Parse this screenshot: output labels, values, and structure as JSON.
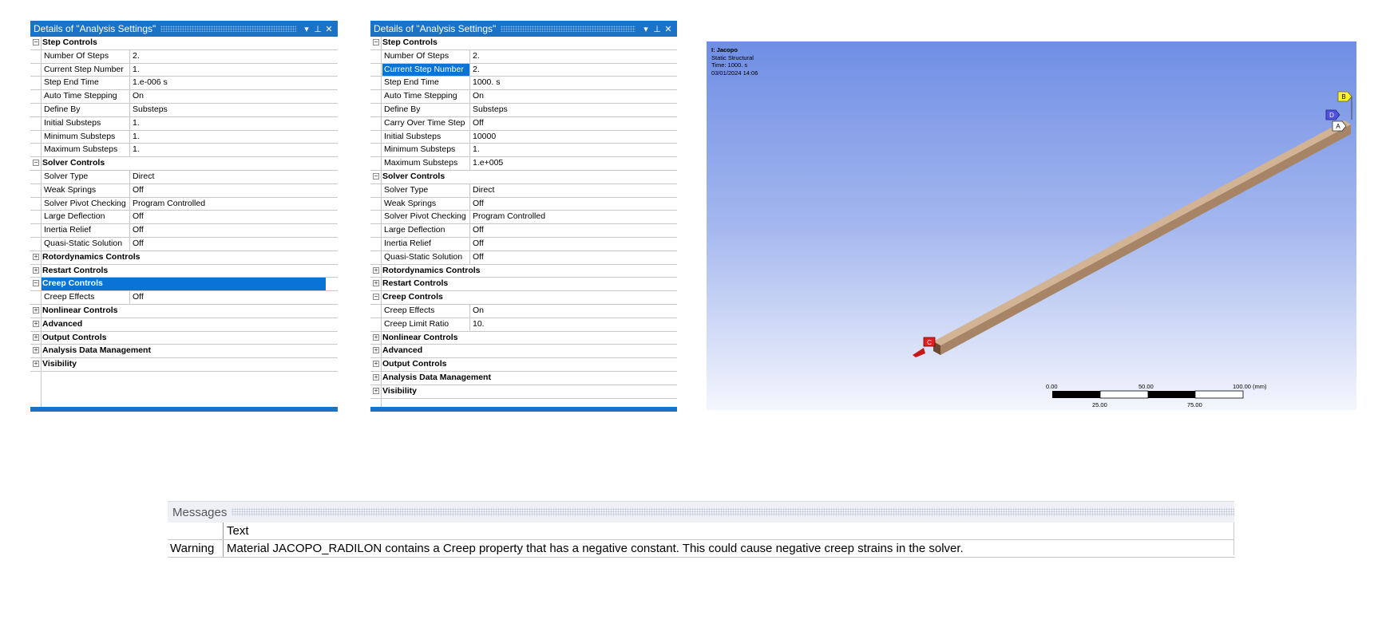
{
  "panel1": {
    "title": "Details of \"Analysis Settings\"",
    "buttons": {
      "menu": "▾",
      "pin": "⊥",
      "close": "✕"
    },
    "rows": [
      {
        "type": "group",
        "label": "Step Controls",
        "state": "−"
      },
      {
        "type": "prop",
        "label": "Number Of Steps",
        "value": "2."
      },
      {
        "type": "prop",
        "label": "Current Step Number",
        "value": "1."
      },
      {
        "type": "prop",
        "label": "Step End Time",
        "value": "1.e-006 s"
      },
      {
        "type": "prop",
        "label": "Auto Time Stepping",
        "value": "On"
      },
      {
        "type": "prop",
        "label": "Define By",
        "value": "Substeps"
      },
      {
        "type": "prop",
        "label": "Initial Substeps",
        "value": "1."
      },
      {
        "type": "prop",
        "label": "Minimum Substeps",
        "value": "1."
      },
      {
        "type": "prop",
        "label": "Maximum Substeps",
        "value": "1."
      },
      {
        "type": "group",
        "label": "Solver Controls",
        "state": "−"
      },
      {
        "type": "prop",
        "label": "Solver Type",
        "value": "Direct"
      },
      {
        "type": "prop",
        "label": "Weak Springs",
        "value": "Off"
      },
      {
        "type": "prop",
        "label": "Solver Pivot Checking",
        "value": "Program Controlled"
      },
      {
        "type": "prop",
        "label": "Large Deflection",
        "value": "Off"
      },
      {
        "type": "prop",
        "label": "Inertia Relief",
        "value": "Off"
      },
      {
        "type": "prop",
        "label": "Quasi-Static Solution",
        "value": "Off"
      },
      {
        "type": "group",
        "label": "Rotordynamics Controls",
        "state": "+"
      },
      {
        "type": "group",
        "label": "Restart Controls",
        "state": "+"
      },
      {
        "type": "group",
        "label": "Creep Controls",
        "state": "−",
        "selected": true
      },
      {
        "type": "prop",
        "label": "Creep Effects",
        "value": "Off"
      },
      {
        "type": "group",
        "label": "Nonlinear Controls",
        "state": "+"
      },
      {
        "type": "group",
        "label": "Advanced",
        "state": "+"
      },
      {
        "type": "group",
        "label": "Output Controls",
        "state": "+"
      },
      {
        "type": "group",
        "label": "Analysis Data Management",
        "state": "+"
      },
      {
        "type": "group",
        "label": "Visibility",
        "state": "+"
      }
    ]
  },
  "panel2": {
    "title": "Details of \"Analysis Settings\"",
    "buttons": {
      "menu": "▾",
      "pin": "⊥",
      "close": "✕"
    },
    "rows": [
      {
        "type": "group",
        "label": "Step Controls",
        "state": "−"
      },
      {
        "type": "prop",
        "label": "Number Of Steps",
        "value": "2."
      },
      {
        "type": "prop",
        "label": "Current Step Number",
        "value": "2.",
        "selected": true
      },
      {
        "type": "prop",
        "label": "Step End Time",
        "value": "1000. s"
      },
      {
        "type": "prop",
        "label": "Auto Time Stepping",
        "value": "On"
      },
      {
        "type": "prop",
        "label": "Define By",
        "value": "Substeps"
      },
      {
        "type": "prop",
        "label": "Carry Over Time Step",
        "value": "Off"
      },
      {
        "type": "prop",
        "label": "Initial Substeps",
        "value": "10000"
      },
      {
        "type": "prop",
        "label": "Minimum Substeps",
        "value": "1."
      },
      {
        "type": "prop",
        "label": "Maximum Substeps",
        "value": "1.e+005"
      },
      {
        "type": "group",
        "label": "Solver Controls",
        "state": "−"
      },
      {
        "type": "prop",
        "label": "Solver Type",
        "value": "Direct"
      },
      {
        "type": "prop",
        "label": "Weak Springs",
        "value": "Off"
      },
      {
        "type": "prop",
        "label": "Solver Pivot Checking",
        "value": "Program Controlled"
      },
      {
        "type": "prop",
        "label": "Large Deflection",
        "value": "Off"
      },
      {
        "type": "prop",
        "label": "Inertia Relief",
        "value": "Off"
      },
      {
        "type": "prop",
        "label": "Quasi-Static Solution",
        "value": "Off"
      },
      {
        "type": "group",
        "label": "Rotordynamics Controls",
        "state": "+"
      },
      {
        "type": "group",
        "label": "Restart Controls",
        "state": "+"
      },
      {
        "type": "group",
        "label": "Creep Controls",
        "state": "−"
      },
      {
        "type": "prop",
        "label": "Creep Effects",
        "value": "On"
      },
      {
        "type": "prop",
        "label": "Creep Limit Ratio",
        "value": "10."
      },
      {
        "type": "group",
        "label": "Nonlinear Controls",
        "state": "+"
      },
      {
        "type": "group",
        "label": "Advanced",
        "state": "+"
      },
      {
        "type": "group",
        "label": "Output Controls",
        "state": "+"
      },
      {
        "type": "group",
        "label": "Analysis Data Management",
        "state": "+"
      },
      {
        "type": "group",
        "label": "Visibility",
        "state": "+"
      }
    ]
  },
  "viewport": {
    "info": {
      "name": "I: Jacopo",
      "analysis": "Static Structural",
      "time": "Time: 1000. s",
      "date": "03/01/2024 14:06"
    },
    "markers": {
      "a": "A",
      "b": "B",
      "c": "C",
      "d": "D"
    },
    "scale": {
      "t0": "0.00",
      "t50": "50.00",
      "t100": "100.00 (mm)",
      "t25": "25.00",
      "t75": "75.00"
    },
    "colors": {
      "beam_top": "#d2b394",
      "beam_side": "#a88466",
      "beam_end": "#6b4a33",
      "marker_a": "#ffffff",
      "marker_b": "#ffef33",
      "marker_c": "#e02020",
      "marker_d": "#5050e6"
    }
  },
  "messages": {
    "title": "Messages",
    "header": {
      "col1": "",
      "col2": "Text"
    },
    "rows": [
      {
        "type": "Warning",
        "text": "Material JACOPO_RADILON contains a Creep property that has a negative constant. This could cause negative creep strains in the solver."
      }
    ]
  },
  "colors": {
    "accent": "#1a73c7",
    "selection": "#0a74d6"
  }
}
